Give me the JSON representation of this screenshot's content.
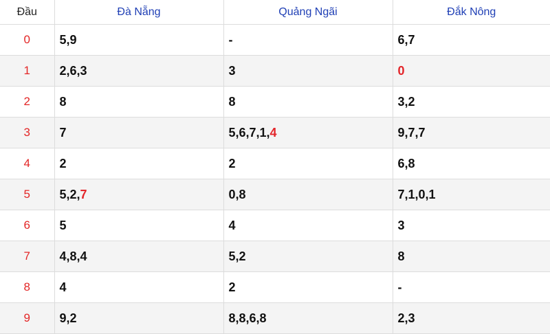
{
  "colors": {
    "header_text": "#1f3fb5",
    "head_digit": "#e32626",
    "highlight": "#e3262b",
    "value_text": "#111111",
    "alt_row_bg": "#f4f4f4"
  },
  "header": {
    "dau": "Đầu",
    "provinces": [
      "Đà Nẵng",
      "Quảng Ngãi",
      "Đắk Nông"
    ]
  },
  "rows": [
    {
      "dau": "0",
      "cells": [
        {
          "plain": "5,9",
          "red": ""
        },
        {
          "plain": "-",
          "red": ""
        },
        {
          "plain": "6,7",
          "red": ""
        }
      ]
    },
    {
      "dau": "1",
      "cells": [
        {
          "plain": "2,6,3",
          "red": ""
        },
        {
          "plain": "3",
          "red": ""
        },
        {
          "plain": "",
          "red": "0"
        }
      ]
    },
    {
      "dau": "2",
      "cells": [
        {
          "plain": "8",
          "red": ""
        },
        {
          "plain": "8",
          "red": ""
        },
        {
          "plain": "3,2",
          "red": ""
        }
      ]
    },
    {
      "dau": "3",
      "cells": [
        {
          "plain": "7",
          "red": ""
        },
        {
          "plain": "5,6,7,1,",
          "red": "4"
        },
        {
          "plain": "9,7,7",
          "red": ""
        }
      ]
    },
    {
      "dau": "4",
      "cells": [
        {
          "plain": "2",
          "red": ""
        },
        {
          "plain": "2",
          "red": ""
        },
        {
          "plain": "6,8",
          "red": ""
        }
      ]
    },
    {
      "dau": "5",
      "cells": [
        {
          "plain": "5,2,",
          "red": "7"
        },
        {
          "plain": "0,8",
          "red": ""
        },
        {
          "plain": "7,1,0,1",
          "red": ""
        }
      ]
    },
    {
      "dau": "6",
      "cells": [
        {
          "plain": "5",
          "red": ""
        },
        {
          "plain": "4",
          "red": ""
        },
        {
          "plain": "3",
          "red": ""
        }
      ]
    },
    {
      "dau": "7",
      "cells": [
        {
          "plain": "4,8,4",
          "red": ""
        },
        {
          "plain": "5,2",
          "red": ""
        },
        {
          "plain": "8",
          "red": ""
        }
      ]
    },
    {
      "dau": "8",
      "cells": [
        {
          "plain": "4",
          "red": ""
        },
        {
          "plain": "2",
          "red": ""
        },
        {
          "plain": "-",
          "red": ""
        }
      ]
    },
    {
      "dau": "9",
      "cells": [
        {
          "plain": "9,2",
          "red": ""
        },
        {
          "plain": "8,8,6,8",
          "red": ""
        },
        {
          "plain": "2,3",
          "red": ""
        }
      ]
    }
  ]
}
